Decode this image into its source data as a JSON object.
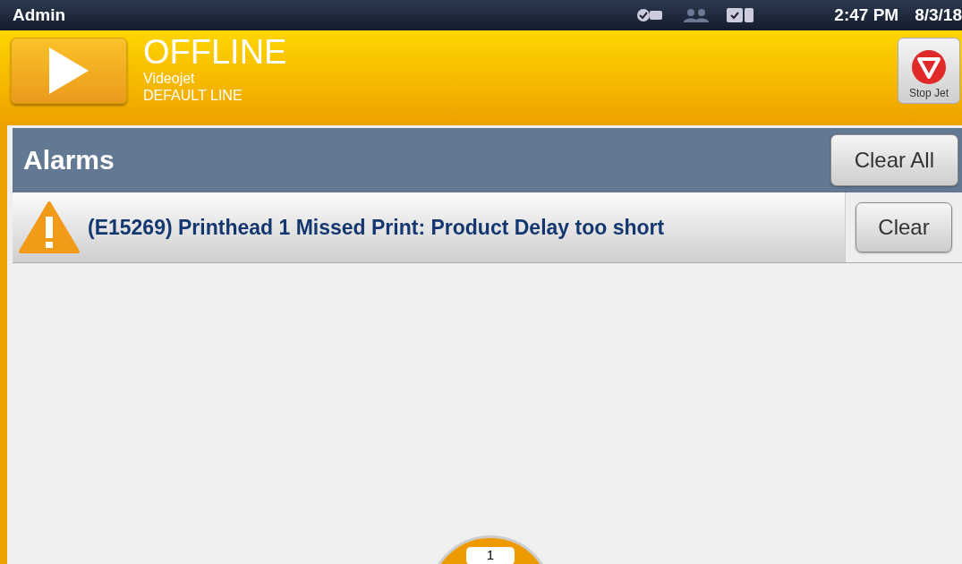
{
  "status_bar": {
    "user": "Admin",
    "time": "2:47 PM",
    "date": "8/3/18"
  },
  "header": {
    "state": "OFFLINE",
    "printer": "Videojet",
    "line": "DEFAULT LINE",
    "stop_button": "Stop Jet"
  },
  "alarms": {
    "title": "Alarms",
    "clear_all": "Clear All",
    "items": [
      {
        "message": "(E15269) Printhead 1 Missed Print: Product Delay too short",
        "clear": "Clear"
      }
    ]
  },
  "page_indicator": "1"
}
